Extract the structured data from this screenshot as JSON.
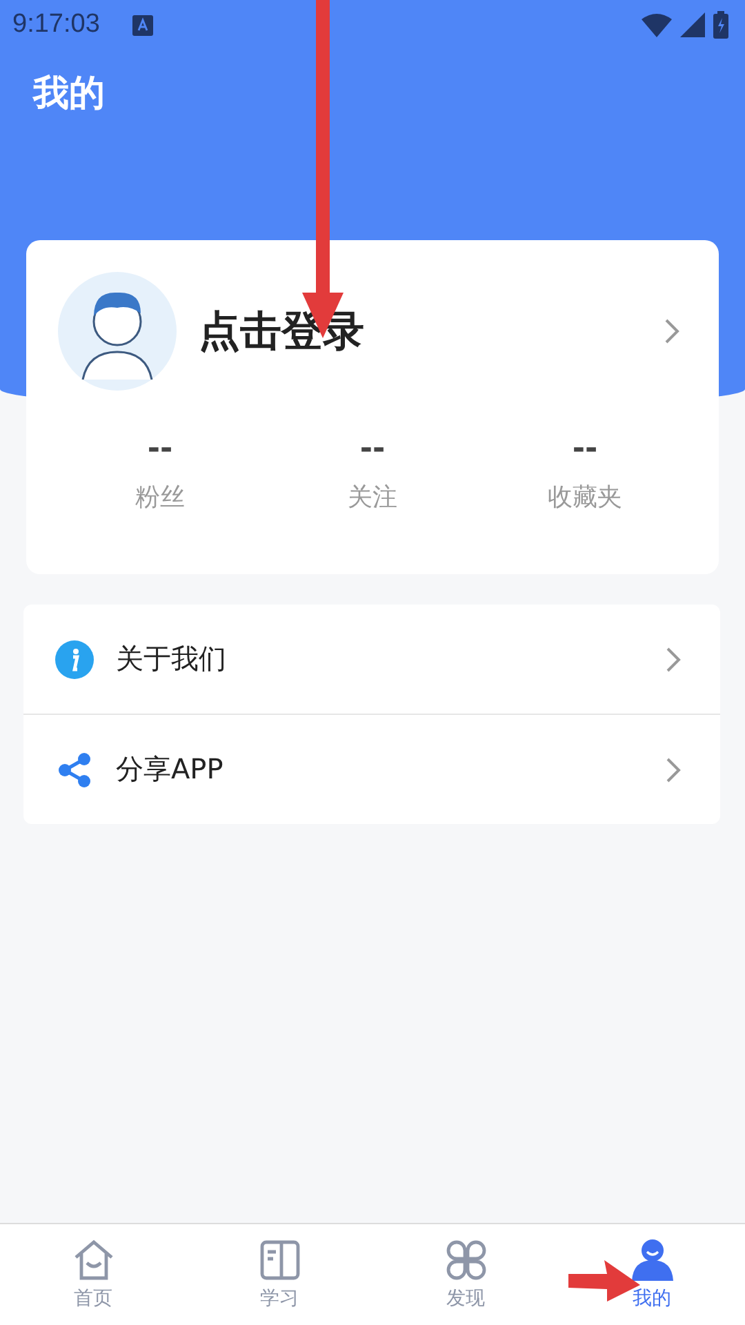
{
  "status_bar": {
    "time": "9:17:03"
  },
  "header": {
    "title": "我的"
  },
  "profile": {
    "name": "点击登录",
    "stats": [
      {
        "value": "--",
        "label": "粉丝"
      },
      {
        "value": "--",
        "label": "关注"
      },
      {
        "value": "--",
        "label": "收藏夹"
      }
    ]
  },
  "menu": [
    {
      "kind": "info",
      "label": "关于我们"
    },
    {
      "kind": "share",
      "label": "分享APP"
    }
  ],
  "tabs": [
    {
      "kind": "home",
      "label": "首页",
      "selected": false
    },
    {
      "kind": "study",
      "label": "学习",
      "selected": false
    },
    {
      "kind": "discover",
      "label": "发现",
      "selected": false
    },
    {
      "kind": "me",
      "label": "我的",
      "selected": true
    }
  ]
}
